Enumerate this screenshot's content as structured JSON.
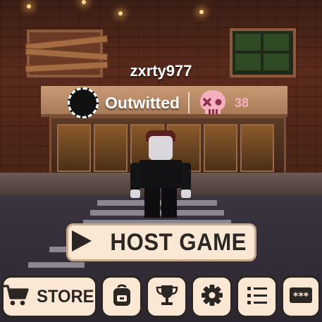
{
  "player": {
    "username": "zxrty977",
    "display_name": "Outwitted",
    "kills": "38"
  },
  "actions": {
    "host_game": "HOST GAME"
  },
  "toolbar": {
    "store_label": "STORE",
    "icons": [
      "cart-icon",
      "backpack-icon",
      "trophy-icon",
      "gear-icon",
      "list-icon",
      "code-icon"
    ]
  },
  "colors": {
    "button_bg": "#fbe8d4",
    "button_text": "#2a2622",
    "kill_accent": "#f4b0bf"
  }
}
